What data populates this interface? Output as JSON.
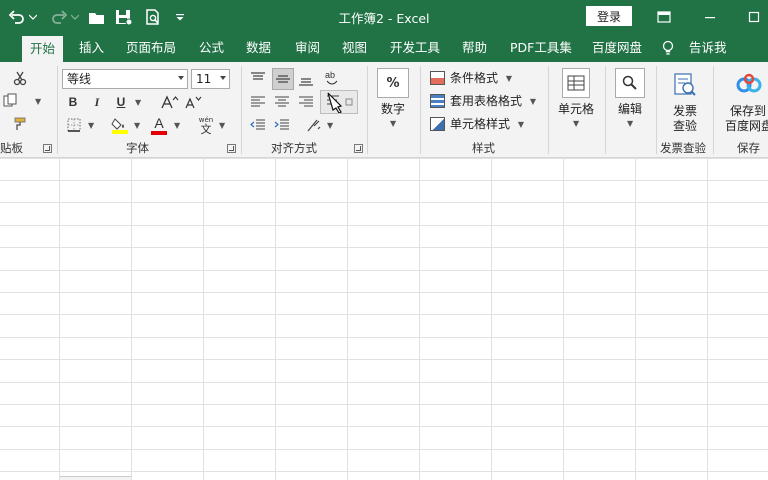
{
  "window": {
    "title": "工作簿2  -  Excel",
    "login_label": "登录",
    "brand_color": "#217346"
  },
  "quick_access": [
    {
      "name": "undo",
      "icon": "undo-icon"
    },
    {
      "name": "redo",
      "icon": "redo-icon"
    },
    {
      "name": "open",
      "icon": "folder-icon"
    },
    {
      "name": "save",
      "icon": "save-icon"
    },
    {
      "name": "print-preview",
      "icon": "print-preview-icon"
    },
    {
      "name": "customize",
      "icon": "chevron-down-icon"
    }
  ],
  "tabs": [
    {
      "label": "开始",
      "active": true
    },
    {
      "label": "插入"
    },
    {
      "label": "页面布局"
    },
    {
      "label": "公式"
    },
    {
      "label": "数据"
    },
    {
      "label": "审阅"
    },
    {
      "label": "视图"
    },
    {
      "label": "开发工具"
    },
    {
      "label": "帮助"
    },
    {
      "label": "PDF工具集"
    },
    {
      "label": "百度网盘"
    },
    {
      "label": "告诉我"
    }
  ],
  "ribbon": {
    "clipboard": {
      "label": "贴板"
    },
    "font": {
      "label": "字体",
      "font_name": "等线",
      "font_size": "11",
      "bold": "B",
      "italic": "I",
      "underline": "U",
      "font_color_letter": "A",
      "phonetic": "wén"
    },
    "alignment": {
      "label": "对齐方式"
    },
    "number": {
      "label": "数字",
      "icon_text": "%"
    },
    "styles": {
      "label": "样式",
      "items": [
        "条件格式",
        "套用表格格式",
        "单元格样式"
      ]
    },
    "cells": {
      "label": "单元格"
    },
    "editing": {
      "label": "编辑"
    },
    "invoice": {
      "label": "发票查验",
      "button_line1": "发票",
      "button_line2": "查验"
    },
    "save": {
      "label": "保存",
      "button_line1": "保存到",
      "button_line2": "百度网盘"
    }
  },
  "colors": {
    "highlight": "#ffff00",
    "font_color": "#e00000",
    "ribbon_bg": "#f3f3f3",
    "grid_line": "#e1e1e1"
  }
}
